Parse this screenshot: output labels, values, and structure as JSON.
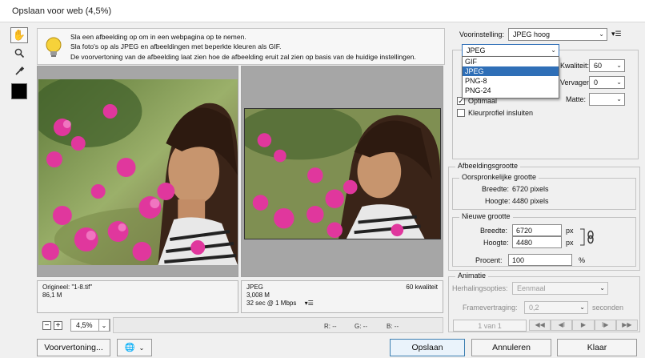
{
  "window": {
    "title": "Opslaan voor web (4,5%)"
  },
  "tools": [
    {
      "name": "hand-tool-icon",
      "glyph": "✋"
    },
    {
      "name": "zoom-tool-icon",
      "glyph": "🔍"
    },
    {
      "name": "eyedropper-tool-icon",
      "glyph": "✒"
    }
  ],
  "info": {
    "line1": "Sla een afbeelding op om in een webpagina op te nemen.",
    "line2": "Sla foto's op als JPEG en afbeeldingen met beperkte kleuren als GIF.",
    "line3": "De voorvertoning van de afbeelding laat zien hoe de afbeelding eruit zal zien op basis van de huidige instellingen."
  },
  "preview_original": {
    "name": "Origineel: \"1-8.tif\"",
    "size": "86,1 M"
  },
  "preview_optimized": {
    "format": "JPEG",
    "quality": "60 kwaliteit",
    "size": "3,008 M",
    "download": "32 sec @ 1 Mbps"
  },
  "zoom": {
    "minus": "−",
    "plus": "+",
    "value": "4,5%"
  },
  "readout": {
    "r": "R: --",
    "g": "G: --",
    "b": "B: --"
  },
  "buttons": {
    "preview": "Voorvertoning...",
    "save": "Opslaan",
    "cancel": "Annuleren",
    "done": "Klaar"
  },
  "settings": {
    "preset_label": "Voorinstelling:",
    "preset_value": "JPEG hoog",
    "format_value": "JPEG",
    "format_options": [
      "GIF",
      "JPEG",
      "PNG-8",
      "PNG-24"
    ],
    "quality_label": "Kwaliteit:",
    "quality_value": "60",
    "blur_label": "Vervagen:",
    "blur_value": "0",
    "optimized_label": "Optimaal",
    "matte_label": "Matte:",
    "embed_profile_label": "Kleurprofiel insluiten"
  },
  "image_size": {
    "group_label": "Afbeeldingsgrootte",
    "original_label": "Oorspronkelijke grootte",
    "orig_width_label": "Breedte:",
    "orig_width_value": "6720 pixels",
    "orig_height_label": "Hoogte:",
    "orig_height_value": "4480 pixels",
    "new_label": "Nieuwe grootte",
    "width_label": "Breedte:",
    "width_value": "6720",
    "height_label": "Hoogte:",
    "height_value": "4480",
    "unit": "px",
    "percent_label": "Procent:",
    "percent_value": "100",
    "percent_unit": "%"
  },
  "animation": {
    "group_label": "Animatie",
    "repeat_label": "Herhalingsopties:",
    "repeat_value": "Eenmaal",
    "delay_label": "Framevertraging:",
    "delay_value": "0,2",
    "delay_unit": "seconden",
    "frame_counter": "1 van 1",
    "controls": [
      "◀◀",
      "◀I",
      "▶",
      "I▶",
      "▶▶"
    ]
  },
  "colors": {
    "accent": "#2f6fb7",
    "dialog_bg": "#f0f0f0",
    "pane_bg": "#a6a6a6"
  }
}
